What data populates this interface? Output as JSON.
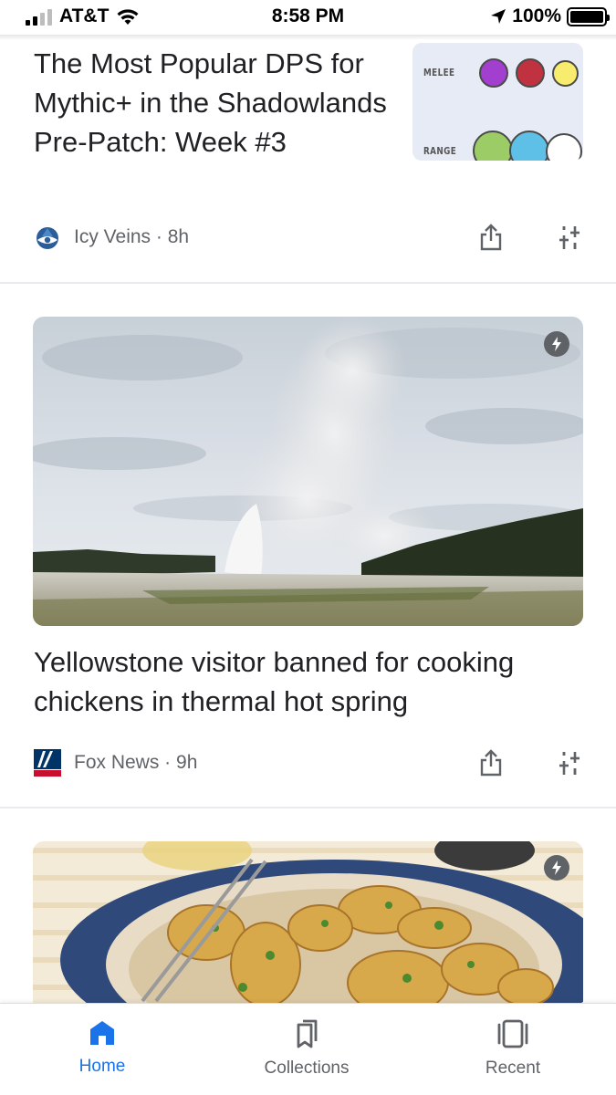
{
  "status_bar": {
    "carrier": "AT&T",
    "time": "8:58 PM",
    "battery": "100%"
  },
  "articles": [
    {
      "title": "The Most Popular DPS for Mythic+ in the Shadowlands Pre-Patch: Week #3",
      "source": "Icy Veins",
      "age": "8h",
      "source_line": "Icy Veins · 8h",
      "thumbnail": {
        "melee_label": "MELEE",
        "range_label": "RANGE",
        "melee_colors": [
          "#a23fcf",
          "#c0323f",
          "#f7ec6e"
        ],
        "range_colors": [
          "#9ccc65",
          "#5ec0e6",
          "#ffffff"
        ]
      }
    },
    {
      "title": "Yellowstone visitor banned for cooking chickens in thermal hot spring",
      "source": "Fox News",
      "age": "9h",
      "source_line": "Fox News · 9h"
    },
    {
      "title": "",
      "source": "",
      "age": ""
    }
  ],
  "bottom_nav": {
    "items": [
      {
        "label": "Home",
        "icon": "home-icon",
        "active": true
      },
      {
        "label": "Collections",
        "icon": "bookmarks-icon",
        "active": false
      },
      {
        "label": "Recent",
        "icon": "recent-icon",
        "active": false
      }
    ]
  },
  "colors": {
    "accent": "#1a73e8",
    "text": "#202124",
    "muted": "#5f6368"
  }
}
